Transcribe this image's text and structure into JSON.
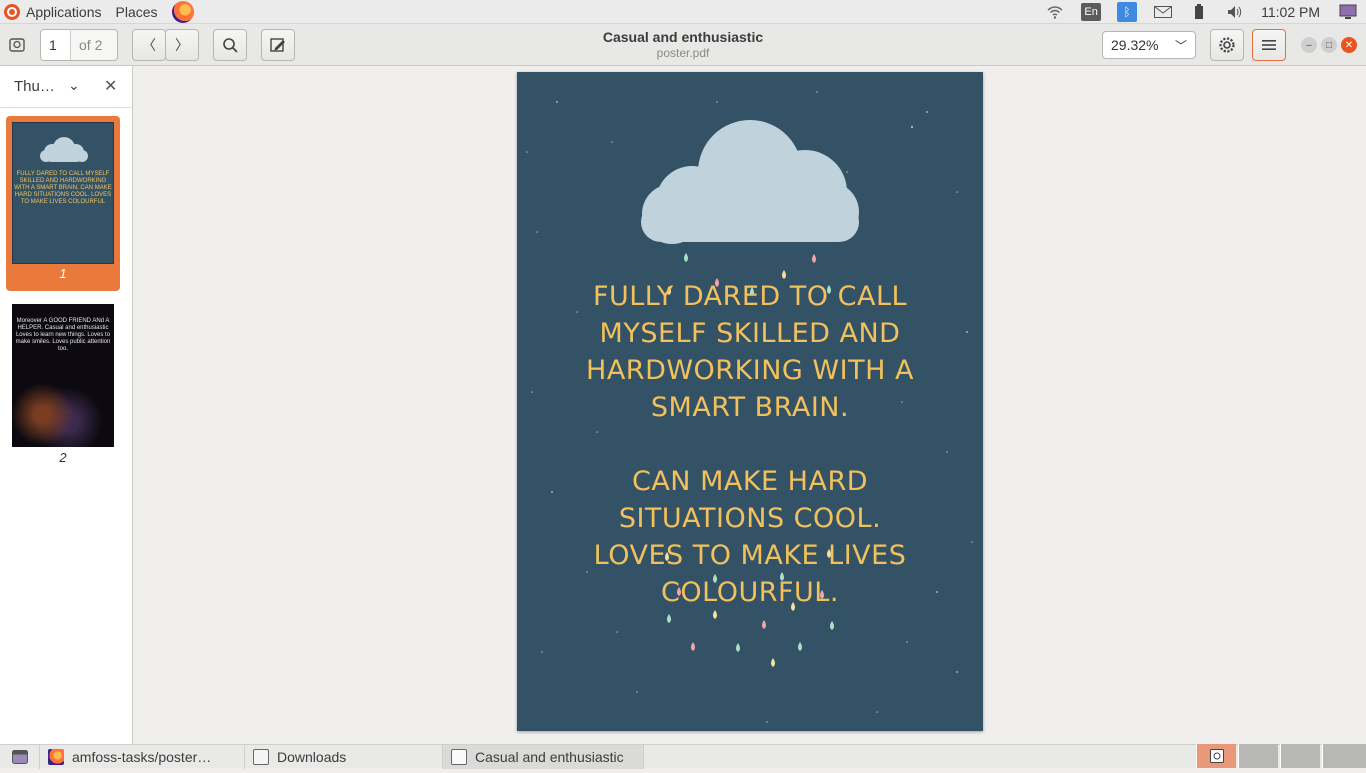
{
  "top_panel": {
    "applications": "Applications",
    "places": "Places",
    "keyboard_layout": "En",
    "clock": "11:02 PM"
  },
  "header": {
    "page_current": "1",
    "page_of": "of 2",
    "title": "Casual and enthusiastic",
    "subtitle": "poster.pdf",
    "zoom": "29.32%"
  },
  "sidebar": {
    "mode_label": "Thu…",
    "thumb1_text": "FULLY DARED TO CALL MYSELF SKILLED AND HARDWORKING WITH A SMART BRAIN. CAN MAKE HARD SITUATIONS COOL. LOVES TO MAKE LIVES COLOURFUL",
    "thumb1_label": "1",
    "thumb2_text": "Moreover A GOOD FRIEND ANd A HELPER. Casual and enthusiastic Loves to learn new things. Loves to make smiles. Loves public attention too.",
    "thumb2_label": "2"
  },
  "poster": {
    "line1": "FULLY DARED TO CALL",
    "line2": "MYSELF SKILLED AND",
    "line3": "HARDWORKING WITH A",
    "line4": "SMART BRAIN.",
    "line5": "CAN MAKE HARD",
    "line6": "SITUATIONS COOL.",
    "line7": "LOVES TO MAKE LIVES",
    "line8": "COLOURFUL."
  },
  "taskbar": {
    "task1": "amfoss-tasks/poster…",
    "task2": "Downloads",
    "task3": "Casual and enthusiastic"
  }
}
